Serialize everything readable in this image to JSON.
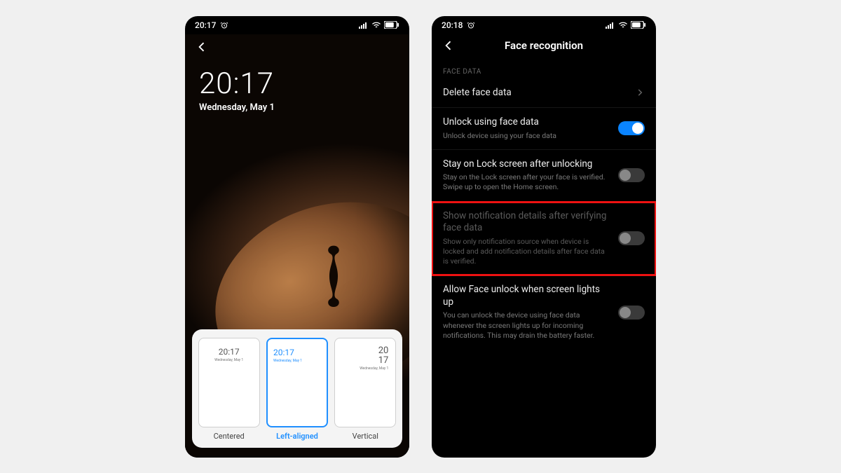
{
  "left": {
    "status_time": "20:17",
    "clock_time": "20:17",
    "clock_date": "Wednesday, May 1",
    "styles": [
      {
        "label": "Centered",
        "thumb_time": "20:17",
        "thumb_date": "Wednesday, May 1",
        "selected": false
      },
      {
        "label": "Left-aligned",
        "thumb_time": "20:17",
        "thumb_date": "Wednesday, May 1",
        "selected": true
      },
      {
        "label": "Vertical",
        "thumb_top": "20",
        "thumb_bottom": "17",
        "thumb_date": "Wednesday, May 1",
        "selected": false
      }
    ]
  },
  "right": {
    "status_time": "20:18",
    "page_title": "Face recognition",
    "section_label": "FACE DATA",
    "rows": {
      "delete": {
        "title": "Delete face data"
      },
      "unlock": {
        "title": "Unlock using face data",
        "sub": "Unlock device using your face data",
        "on": true
      },
      "stay": {
        "title": "Stay on Lock screen after unlocking",
        "sub": "Stay on the Lock screen after your face is verified. Swipe up to open the Home screen.",
        "on": false
      },
      "notif": {
        "title": "Show notification details after verifying face data",
        "sub": "Show only notification source when device is locked and add notification details after face data is verified.",
        "on": false
      },
      "allow": {
        "title": "Allow Face unlock when screen lights up",
        "sub": "You can unlock the device using face data whenever the screen lights up for incoming notifications. This may drain the battery faster.",
        "on": false
      }
    }
  },
  "colors": {
    "accent": "#0a84ff",
    "highlight": "#e11"
  }
}
